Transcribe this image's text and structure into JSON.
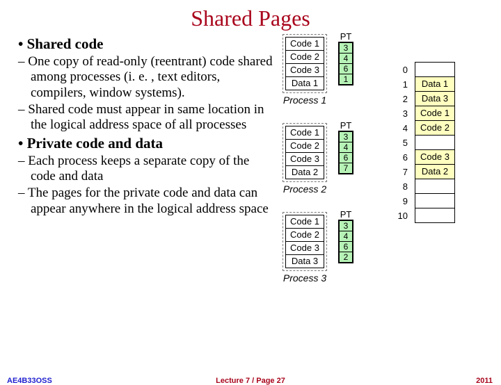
{
  "title": "Shared Pages",
  "bullets": {
    "h1": "Shared code",
    "s1": "One copy of read-only (reentrant) code shared among processes (i. e. , text editors, compilers, window systems).",
    "s2": "Shared code must appear in same location in the logical address space of all processes",
    "h2": "Private code and data",
    "s3": "Each process keeps a separate copy of the code and data",
    "s4": "The pages for the private code and data can appear anywhere in the logical address space"
  },
  "labels": {
    "pt": "PT",
    "code1": "Code 1",
    "code2": "Code 2",
    "code3": "Code 3",
    "data1": "Data 1",
    "data2": "Data 2",
    "data3": "Data 3",
    "proc1": "Process 1",
    "proc2": "Process 2",
    "proc3": "Process 3"
  },
  "chart_data": {
    "type": "table",
    "processes": [
      {
        "name": "Process 1",
        "pages": [
          "Code 1",
          "Code 2",
          "Code 3",
          "Data 1"
        ],
        "pt": [
          3,
          4,
          6,
          1
        ]
      },
      {
        "name": "Process 2",
        "pages": [
          "Code 1",
          "Code 2",
          "Code 3",
          "Data 2"
        ],
        "pt": [
          3,
          4,
          6,
          7
        ]
      },
      {
        "name": "Process 3",
        "pages": [
          "Code 1",
          "Code 2",
          "Code 3",
          "Data 3"
        ],
        "pt": [
          3,
          4,
          6,
          2
        ]
      }
    ],
    "memory_frames": [
      {
        "frame": 0,
        "content": ""
      },
      {
        "frame": 1,
        "content": "Data 1"
      },
      {
        "frame": 2,
        "content": "Data 3"
      },
      {
        "frame": 3,
        "content": "Code 1"
      },
      {
        "frame": 4,
        "content": "Code 2"
      },
      {
        "frame": 5,
        "content": ""
      },
      {
        "frame": 6,
        "content": "Code 3"
      },
      {
        "frame": 7,
        "content": "Data 2"
      },
      {
        "frame": 8,
        "content": ""
      },
      {
        "frame": 9,
        "content": ""
      },
      {
        "frame": 10,
        "content": ""
      }
    ]
  },
  "pt": {
    "p1": [
      "3",
      "4",
      "6",
      "1"
    ],
    "p2": [
      "3",
      "4",
      "6",
      "7"
    ],
    "p3": [
      "3",
      "4",
      "6",
      "2"
    ]
  },
  "mem": {
    "i0": "0",
    "i1": "1",
    "i2": "2",
    "i3": "3",
    "i4": "4",
    "i5": "5",
    "i6": "6",
    "i7": "7",
    "i8": "8",
    "i9": "9",
    "i10": "10"
  },
  "footer": {
    "left": "AE4B33OSS",
    "center": "Lecture 7 / Page 27",
    "right": "2011"
  }
}
